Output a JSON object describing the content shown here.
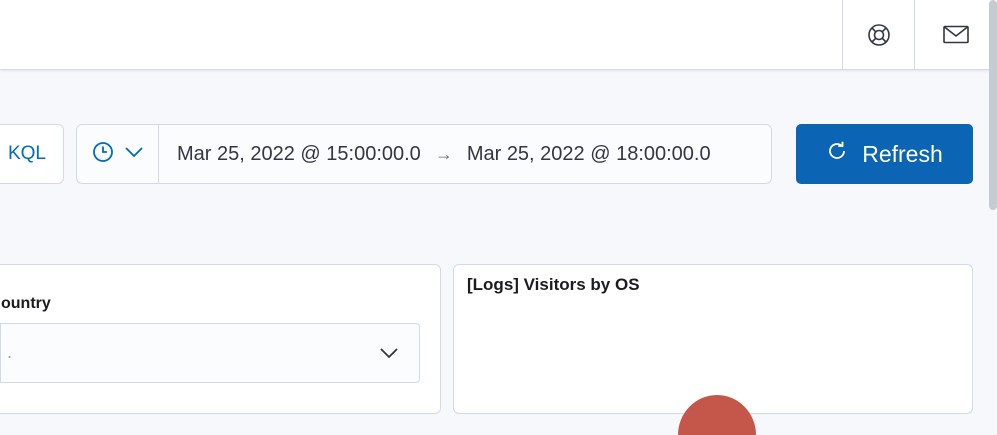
{
  "header": {
    "help_icon": "help-lifebuoy-icon",
    "mail_icon": "mail-icon"
  },
  "query_bar": {
    "language_label": "KQL",
    "quick_select_icon": "clock-icon",
    "start_date": "Mar 25, 2022 @ 15:00:00.0",
    "range_arrow": "→",
    "end_date": "Mar 25, 2022 @ 18:00:00.0",
    "refresh_label": "Refresh"
  },
  "panels": {
    "controls": {
      "label": "ountry",
      "select_placeholder": "."
    },
    "visitors_by_os": {
      "title": "[Logs] Visitors by OS",
      "slice_color": "#c4564a"
    }
  },
  "colors": {
    "primary": "#0b64b4",
    "link": "#006bb8",
    "border": "#d3dae6"
  }
}
